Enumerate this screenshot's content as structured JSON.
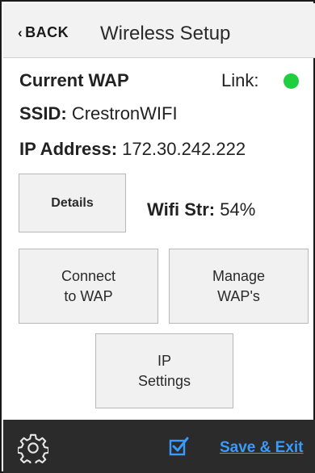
{
  "header": {
    "back_label": "BACK",
    "title": "Wireless Setup"
  },
  "current_wap": {
    "heading": "Current WAP",
    "link_label": "Link:",
    "link_status_color": "#1fcf3f",
    "ssid_label": "SSID:",
    "ssid_value": "CrestronWIFI",
    "ip_label": "IP Address:",
    "ip_value": "172.30.242.222"
  },
  "buttons": {
    "details": "Details",
    "connect": "Connect\nto WAP",
    "manage": "Manage\nWAP's",
    "ip_settings": "IP\nSettings"
  },
  "wifi_strength": {
    "label": "Wifi Str:",
    "value": "54%"
  },
  "footer": {
    "save_exit": "Save & Exit",
    "gear_icon": "gear-icon",
    "check_icon": "checkbox-checked-icon",
    "accent_color": "#3a9bff",
    "background_color": "#2b2b2b"
  }
}
